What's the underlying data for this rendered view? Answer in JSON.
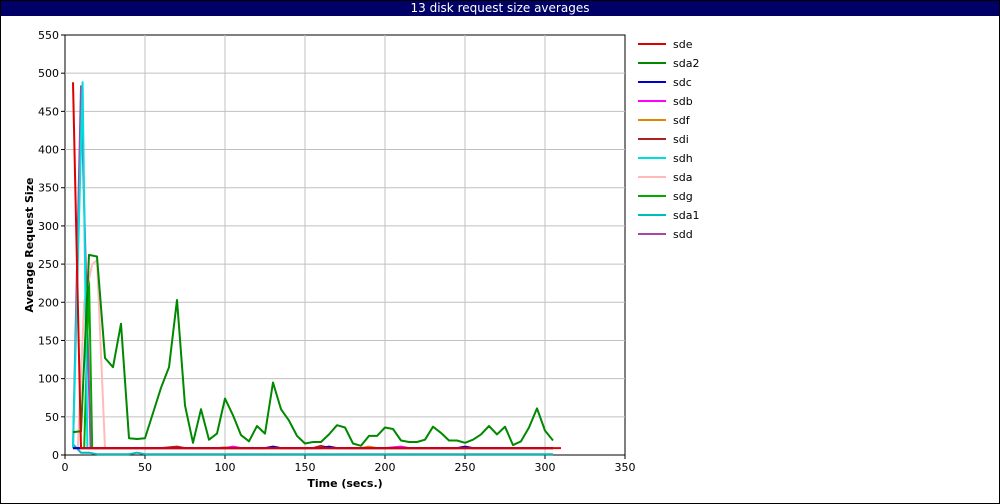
{
  "window": {
    "title": "13 disk request size averages"
  },
  "chart_data": {
    "type": "line",
    "title": "13 disk request size averages",
    "xlabel": "Time (secs.)",
    "ylabel": "Average Request Size",
    "xlim": [
      0,
      350
    ],
    "ylim": [
      0,
      550
    ],
    "xticks": [
      0,
      50,
      100,
      150,
      200,
      250,
      300,
      350
    ],
    "yticks": [
      0,
      50,
      100,
      150,
      200,
      250,
      300,
      350,
      400,
      450,
      500,
      550
    ],
    "grid": true,
    "legend_position": "right",
    "series": [
      {
        "name": "sde",
        "color": "#dd0000",
        "points": [
          [
            5,
            488
          ],
          [
            10,
            9
          ],
          [
            20,
            9
          ],
          [
            50,
            9
          ],
          [
            100,
            9
          ],
          [
            150,
            9
          ],
          [
            200,
            9
          ],
          [
            250,
            9
          ],
          [
            300,
            9
          ],
          [
            310,
            9
          ]
        ]
      },
      {
        "name": "sda2",
        "color": "#008800",
        "points": [
          [
            5,
            30
          ],
          [
            10,
            31
          ],
          [
            15,
            262
          ],
          [
            20,
            260
          ],
          [
            25,
            127
          ],
          [
            30,
            115
          ],
          [
            35,
            172
          ],
          [
            40,
            22
          ],
          [
            45,
            21
          ],
          [
            50,
            22
          ],
          [
            55,
            55
          ],
          [
            60,
            88
          ],
          [
            65,
            115
          ],
          [
            70,
            203
          ],
          [
            75,
            65
          ],
          [
            80,
            16
          ],
          [
            85,
            60
          ],
          [
            90,
            20
          ],
          [
            95,
            28
          ],
          [
            100,
            74
          ],
          [
            105,
            52
          ],
          [
            110,
            26
          ],
          [
            115,
            18
          ],
          [
            120,
            38
          ],
          [
            125,
            28
          ],
          [
            130,
            95
          ],
          [
            135,
            60
          ],
          [
            140,
            45
          ],
          [
            145,
            25
          ],
          [
            150,
            15
          ],
          [
            155,
            17
          ],
          [
            160,
            17
          ],
          [
            165,
            27
          ],
          [
            170,
            39
          ],
          [
            175,
            36
          ],
          [
            180,
            15
          ],
          [
            185,
            12
          ],
          [
            190,
            25
          ],
          [
            195,
            25
          ],
          [
            200,
            36
          ],
          [
            205,
            34
          ],
          [
            210,
            19
          ],
          [
            215,
            17
          ],
          [
            220,
            17
          ],
          [
            225,
            20
          ],
          [
            230,
            37
          ],
          [
            235,
            29
          ],
          [
            240,
            19
          ],
          [
            245,
            19
          ],
          [
            250,
            16
          ],
          [
            255,
            20
          ],
          [
            260,
            27
          ],
          [
            265,
            38
          ],
          [
            270,
            27
          ],
          [
            275,
            37
          ],
          [
            280,
            13
          ],
          [
            285,
            18
          ],
          [
            290,
            36
          ],
          [
            295,
            61
          ],
          [
            300,
            32
          ],
          [
            305,
            19
          ]
        ]
      },
      {
        "name": "sdc",
        "color": "#0000cc",
        "points": [
          [
            5,
            9
          ],
          [
            50,
            9
          ],
          [
            125,
            9
          ],
          [
            130,
            11
          ],
          [
            135,
            9
          ],
          [
            160,
            9
          ],
          [
            165,
            11
          ],
          [
            170,
            9
          ],
          [
            245,
            9
          ],
          [
            250,
            11
          ],
          [
            255,
            9
          ],
          [
            305,
            9
          ]
        ]
      },
      {
        "name": "sdb",
        "color": "#ff00ff",
        "points": [
          [
            5,
            9
          ],
          [
            100,
            9
          ],
          [
            105,
            11
          ],
          [
            110,
            9
          ],
          [
            200,
            9
          ],
          [
            210,
            11
          ],
          [
            215,
            9
          ],
          [
            305,
            9
          ]
        ]
      },
      {
        "name": "sdf",
        "color": "#dd8800",
        "points": [
          [
            5,
            9
          ],
          [
            95,
            9
          ],
          [
            100,
            10
          ],
          [
            105,
            9
          ],
          [
            185,
            9
          ],
          [
            190,
            11
          ],
          [
            195,
            9
          ],
          [
            305,
            9
          ]
        ]
      },
      {
        "name": "sdi",
        "color": "#aa2222",
        "points": [
          [
            5,
            9
          ],
          [
            60,
            9
          ],
          [
            70,
            11
          ],
          [
            75,
            9
          ],
          [
            155,
            9
          ],
          [
            160,
            12
          ],
          [
            165,
            9
          ],
          [
            305,
            9
          ]
        ]
      },
      {
        "name": "sdh",
        "color": "#00dddd",
        "points": [
          [
            5,
            9
          ],
          [
            11,
            488
          ],
          [
            14,
            9
          ],
          [
            305,
            9
          ]
        ]
      },
      {
        "name": "sda",
        "color": "#ffbbbb",
        "points": [
          [
            8,
            9
          ],
          [
            12,
            200
          ],
          [
            17,
            250
          ],
          [
            20,
            255
          ],
          [
            25,
            9
          ],
          [
            305,
            9
          ]
        ]
      },
      {
        "name": "sdg",
        "color": "#00aa00",
        "points": [
          [
            5,
            9
          ],
          [
            12,
            9
          ],
          [
            15,
            230
          ],
          [
            17,
            9
          ],
          [
            305,
            9
          ]
        ]
      },
      {
        "name": "sda1",
        "color": "#00bbbb",
        "points": [
          [
            5,
            14
          ],
          [
            10,
            3
          ],
          [
            15,
            3
          ],
          [
            20,
            1
          ],
          [
            40,
            1
          ],
          [
            45,
            3
          ],
          [
            50,
            1
          ],
          [
            305,
            1
          ]
        ]
      },
      {
        "name": "sdd",
        "color": "#aa44aa",
        "points": [
          [
            5,
            9
          ],
          [
            10,
            483
          ],
          [
            16,
            9
          ],
          [
            305,
            9
          ]
        ]
      }
    ]
  }
}
